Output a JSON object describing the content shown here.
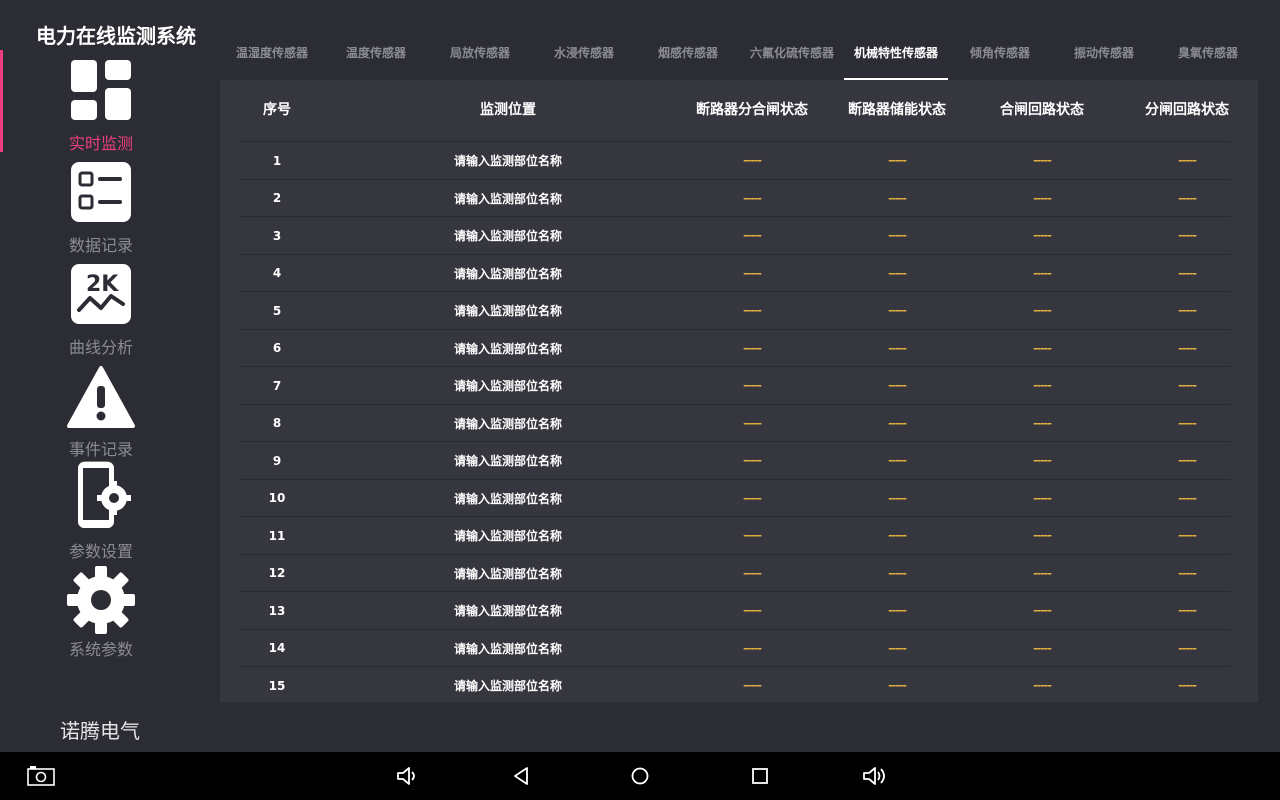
{
  "app": {
    "title": "电力在线监测系统",
    "brand": "诺腾电气"
  },
  "sidebar": {
    "items": [
      {
        "label": "实时监测",
        "icon": "dashboard-icon",
        "active": true
      },
      {
        "label": "数据记录",
        "icon": "list-icon",
        "active": false
      },
      {
        "label": "曲线分析",
        "icon": "chart-icon",
        "active": false
      },
      {
        "label": "事件记录",
        "icon": "warning-icon",
        "active": false
      },
      {
        "label": "参数设置",
        "icon": "device-settings-icon",
        "active": false
      },
      {
        "label": "系统参数",
        "icon": "gear-icon",
        "active": false
      }
    ]
  },
  "tabs": [
    {
      "label": "温湿度传感器",
      "active": false
    },
    {
      "label": "温度传感器",
      "active": false
    },
    {
      "label": "局放传感器",
      "active": false
    },
    {
      "label": "水浸传感器",
      "active": false
    },
    {
      "label": "烟感传感器",
      "active": false
    },
    {
      "label": "六氟化硫传感器",
      "active": false
    },
    {
      "label": "机械特性传感器",
      "active": true
    },
    {
      "label": "倾角传感器",
      "active": false
    },
    {
      "label": "振动传感器",
      "active": false
    },
    {
      "label": "臭氧传感器",
      "active": false
    }
  ],
  "table": {
    "columns": [
      "序号",
      "监测位置",
      "断路器分合闸状态",
      "断路器储能状态",
      "合闸回路状态",
      "分闸回路状态"
    ],
    "rows": [
      [
        "1",
        "请输入监测部位名称",
        "-----",
        "-----",
        "-----",
        "-----"
      ],
      [
        "2",
        "请输入监测部位名称",
        "-----",
        "-----",
        "-----",
        "-----"
      ],
      [
        "3",
        "请输入监测部位名称",
        "-----",
        "-----",
        "-----",
        "-----"
      ],
      [
        "4",
        "请输入监测部位名称",
        "-----",
        "-----",
        "-----",
        "-----"
      ],
      [
        "5",
        "请输入监测部位名称",
        "-----",
        "-----",
        "-----",
        "-----"
      ],
      [
        "6",
        "请输入监测部位名称",
        "-----",
        "-----",
        "-----",
        "-----"
      ],
      [
        "7",
        "请输入监测部位名称",
        "-----",
        "-----",
        "-----",
        "-----"
      ],
      [
        "8",
        "请输入监测部位名称",
        "-----",
        "-----",
        "-----",
        "-----"
      ],
      [
        "9",
        "请输入监测部位名称",
        "-----",
        "-----",
        "-----",
        "-----"
      ],
      [
        "10",
        "请输入监测部位名称",
        "-----",
        "-----",
        "-----",
        "-----"
      ],
      [
        "11",
        "请输入监测部位名称",
        "-----",
        "-----",
        "-----",
        "-----"
      ],
      [
        "12",
        "请输入监测部位名称",
        "-----",
        "-----",
        "-----",
        "-----"
      ],
      [
        "13",
        "请输入监测部位名称",
        "-----",
        "-----",
        "-----",
        "-----"
      ],
      [
        "14",
        "请输入监测部位名称",
        "-----",
        "-----",
        "-----",
        "-----"
      ],
      [
        "15",
        "请输入监测部位名称",
        "-----",
        "-----",
        "-----",
        "-----"
      ]
    ]
  },
  "navbar": {
    "buttons": [
      "screenshot-icon",
      "volume-down-icon",
      "back-icon",
      "home-icon",
      "recents-icon",
      "volume-up-icon"
    ]
  },
  "colors": {
    "accent": "#ee3e7d",
    "background": "#2c2d34",
    "panel": "#35363e",
    "dash": "#e5b13f",
    "muted": "#8b8c92"
  }
}
